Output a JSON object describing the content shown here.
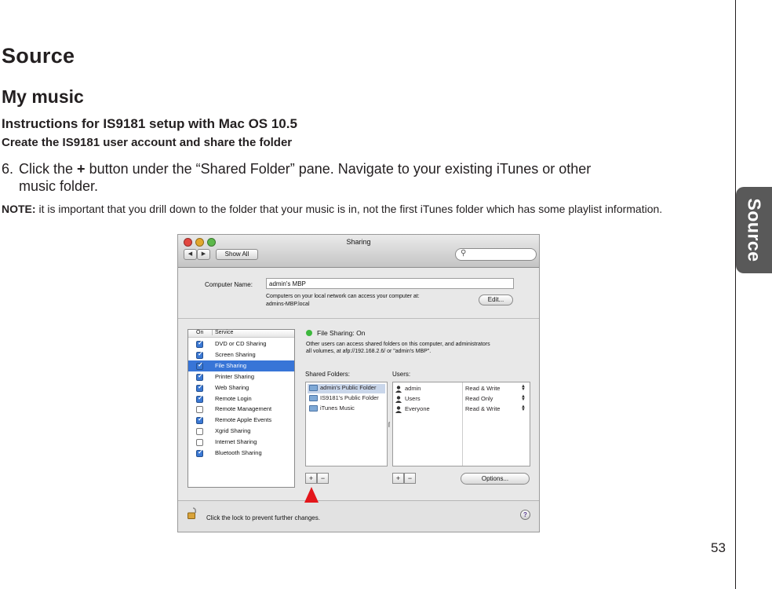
{
  "page": {
    "title": "Source",
    "subtitle": "My music",
    "heading": "Instructions for IS9181 setup with Mac OS 10.5",
    "subheading": "Create the IS9181 user account and share the folder",
    "step_number": "6.",
    "step_text_1": "Click the",
    "step_plus": "+",
    "step_text_2": "button under the “Shared Folder” pane. Navigate to your existing iTunes or other",
    "step_text_3": "music folder.",
    "note_label": "NOTE:",
    "note_text": "it is important that you drill down to the folder that your music is in, not the first iTunes folder which has some playlist information.",
    "side_tab": "Source",
    "page_number": "53"
  },
  "window": {
    "title": "Sharing",
    "show_all": "Show All",
    "back_glyph": "◀",
    "forward_glyph": "▶",
    "computer_name_label": "Computer Name:",
    "computer_name_value": "admin's MBP",
    "network_note_1": "Computers on your local network can access your computer at:",
    "network_note_2": "admins-MBP.local",
    "edit_button": "Edit...",
    "service_col_on": "On",
    "service_col_service": "Service",
    "services": [
      {
        "label": "DVD or CD Sharing",
        "on": true
      },
      {
        "label": "Screen Sharing",
        "on": true
      },
      {
        "label": "File Sharing",
        "on": true,
        "selected": true
      },
      {
        "label": "Printer Sharing",
        "on": true
      },
      {
        "label": "Web Sharing",
        "on": true
      },
      {
        "label": "Remote Login",
        "on": true
      },
      {
        "label": "Remote Management",
        "on": false
      },
      {
        "label": "Remote Apple Events",
        "on": true
      },
      {
        "label": "Xgrid Sharing",
        "on": false
      },
      {
        "label": "Internet Sharing",
        "on": false
      },
      {
        "label": "Bluetooth Sharing",
        "on": true
      }
    ],
    "status_label": "File Sharing: On",
    "status_color": "#3db83d",
    "status_desc_1": "Other users can access shared folders on this computer, and administrators",
    "status_desc_2": "all volumes, at afp://192.168.2.6/ or \"admin's MBP\".",
    "shared_folders_label": "Shared Folders:",
    "users_label": "Users:",
    "folders": [
      "admin's Public Folder",
      "IS9181's Public Folder",
      "iTunes Music"
    ],
    "users": [
      {
        "name": "admin",
        "perm": "Read & Write"
      },
      {
        "name": "Users",
        "perm": "Read Only"
      },
      {
        "name": "Everyone",
        "perm": "Read & Write"
      }
    ],
    "plus": "+",
    "minus": "−",
    "options_button": "Options...",
    "lock_text": "Click the lock to prevent further changes.",
    "help": "?"
  },
  "colors": {
    "selection": "#3875d7",
    "arrow": "#e3161b",
    "side_tab": "#595959"
  }
}
